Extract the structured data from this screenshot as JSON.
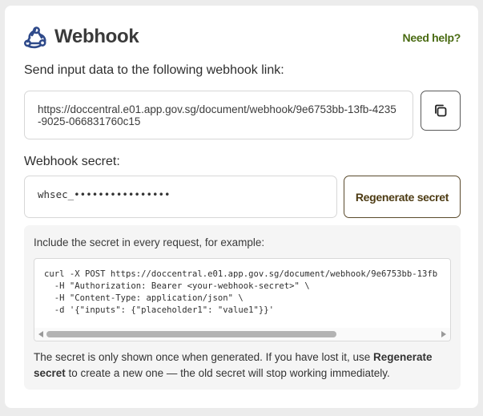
{
  "header": {
    "title": "Webhook",
    "help_link": "Need help?",
    "logo_icon": "webhook-icon"
  },
  "webhook_link": {
    "label": "Send input data to the following webhook link:",
    "url": "https://doccentral.e01.app.gov.sg/document/webhook/9e6753bb-13fb-4235-9025-066831760c15",
    "copy_icon": "copy-icon"
  },
  "secret": {
    "label": "Webhook secret:",
    "value": "whsec_••••••••••••••••",
    "regenerate_label": "Regenerate secret"
  },
  "example": {
    "intro": "Include the secret in every request, for example:",
    "code_lines": [
      "curl -X POST https://doccentral.e01.app.gov.sg/document/webhook/9e6753bb-13fb",
      "  -H \"Authorization: Bearer <your-webhook-secret>\" \\",
      "  -H \"Content-Type: application/json\" \\",
      "  -d '{\"inputs\": {\"placeholder1\": \"value1\"}}'"
    ],
    "note_before": "The secret is only shown once when generated. If you have lost it, use ",
    "note_bold": "Regenerate secret",
    "note_after": " to create a new one — the old secret will stop working immediately."
  },
  "colors": {
    "help_link": "#4a6b13",
    "logo": "#2f4a8a",
    "regenerate_border": "#5a4a2c"
  }
}
